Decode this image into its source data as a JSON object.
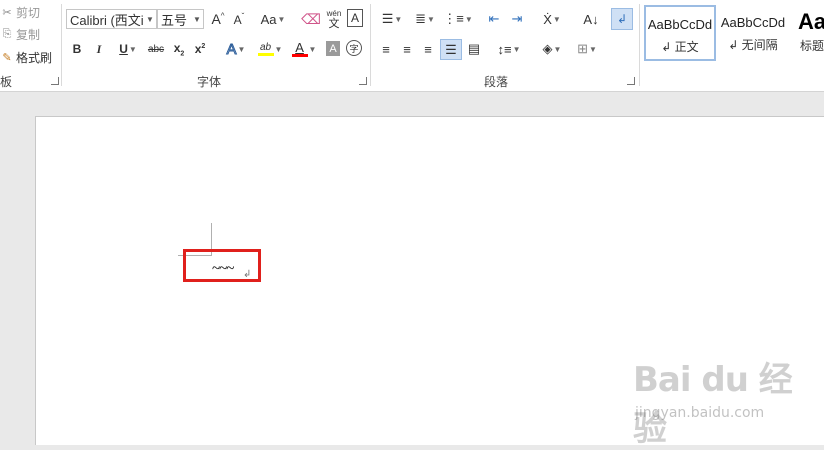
{
  "clipboard": {
    "cut_label": "剪切",
    "copy_label": "复制",
    "format_painter_label": "格式刷",
    "group_label": "板"
  },
  "font": {
    "font_name": "Calibri (西文i",
    "font_size": "五号",
    "group_label": "字体",
    "change_case_label": "Aa",
    "phonetic_top": "wén",
    "phonetic_bottom": "文",
    "border_char": "A",
    "bold": "B",
    "italic": "I",
    "underline": "U",
    "strikethrough": "abc",
    "subscript_base": "x",
    "subscript_mark": "2",
    "superscript_base": "x",
    "superscript_mark": "2",
    "text_effect": "A",
    "highlight": "ab",
    "font_color": "A",
    "char_shading": "A",
    "enclose_char": "字",
    "highlight_color": "#ffff00",
    "font_color_value": "#ff0000"
  },
  "paragraph": {
    "group_label": "段落"
  },
  "styles": {
    "items": [
      {
        "sample": "AaBbCcDd",
        "name": "↲ 正文"
      },
      {
        "sample": "AaBbCcDd",
        "name": "↲ 无间隔"
      },
      {
        "sample": "Aa",
        "name": "标题"
      }
    ]
  },
  "document": {
    "text": "~~~",
    "paragraph_mark": "↲"
  },
  "watermark": {
    "main": "Bai du 经验",
    "sub": "jingyan.baidu.com"
  },
  "colors": {
    "highlight_frame": "#e0201c",
    "selected_style_border": "#9bbce3"
  }
}
